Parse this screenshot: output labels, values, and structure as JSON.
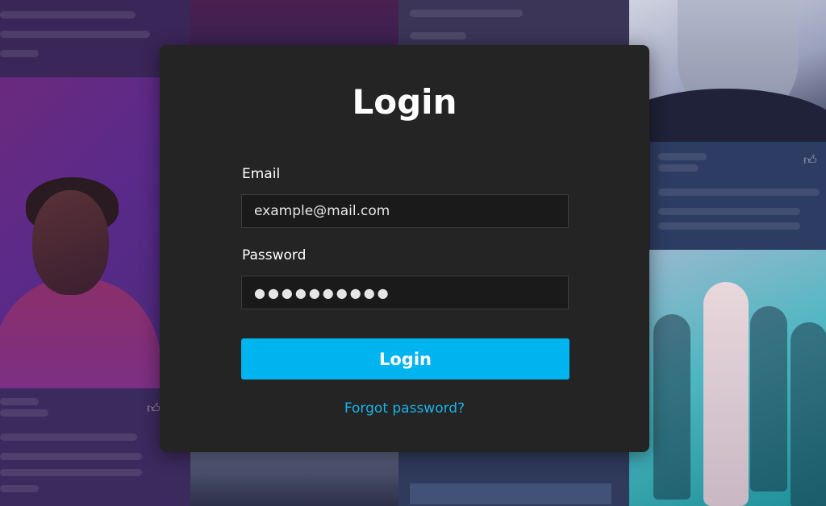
{
  "login_dialog": {
    "title": "Login",
    "email": {
      "label": "Email",
      "value": "example@mail.com"
    },
    "password": {
      "label": "Password",
      "value": "●●●●●●●●●●"
    },
    "submit_label": "Login",
    "forgot_link": "Forgot password?"
  },
  "background": {
    "icons": [
      "thumbs-up-icon",
      "thumbs-up-icon"
    ]
  },
  "colors": {
    "accent": "#00b4ef",
    "link": "#19b3e8",
    "dialog_bg": "#242424",
    "field_bg": "#1a1a1a"
  }
}
